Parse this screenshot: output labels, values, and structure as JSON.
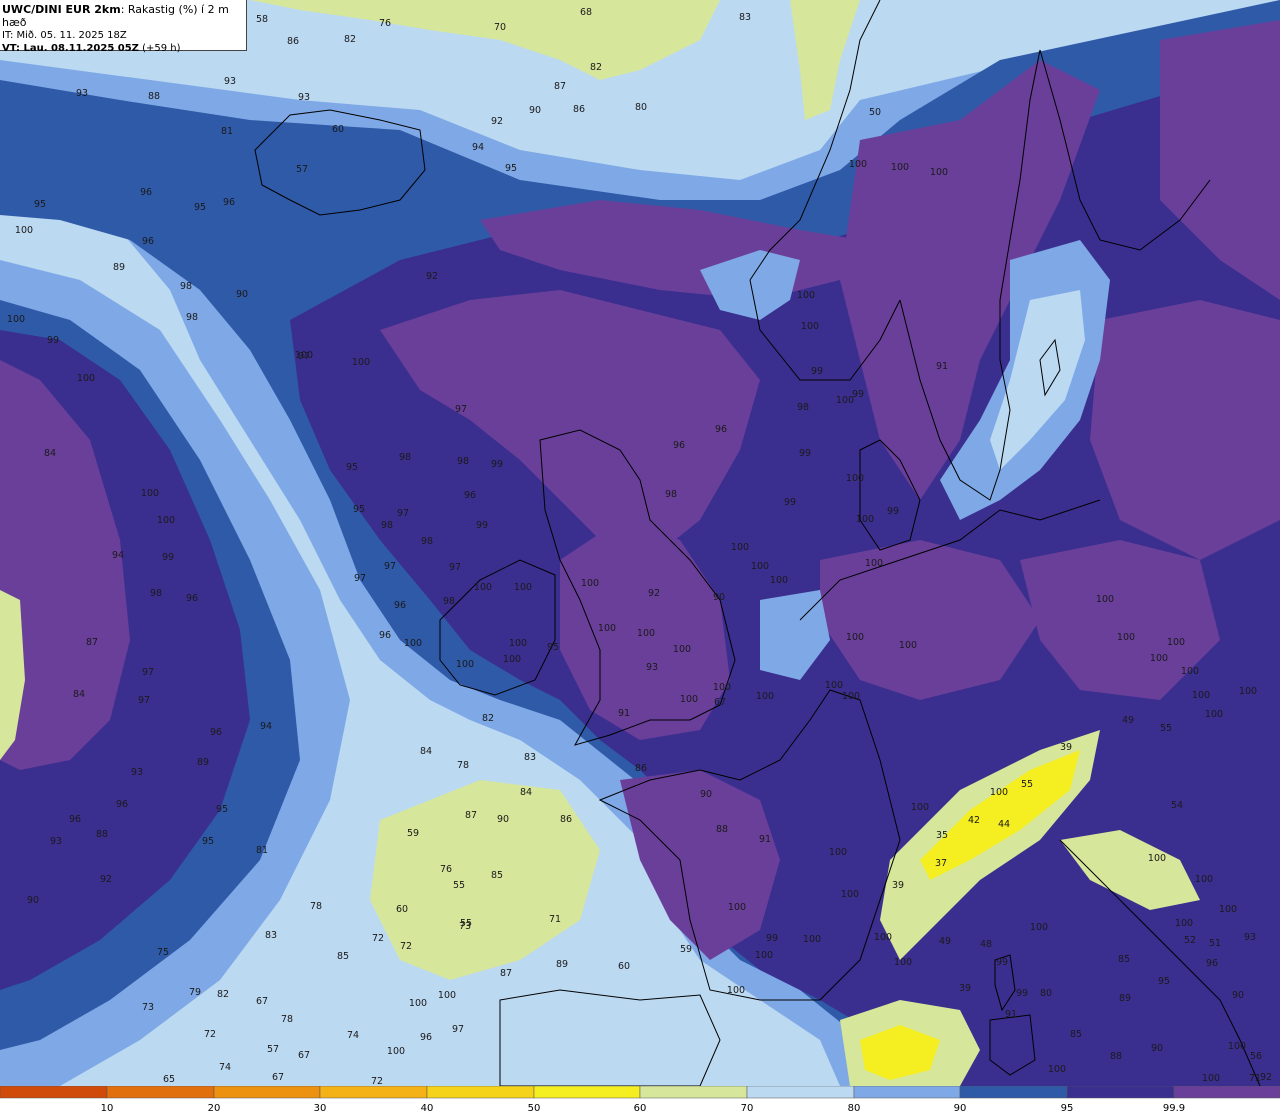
{
  "header": {
    "model": "UWC/DINI EUR 2km",
    "field": ": Rakastig (%) í 2 m hæð",
    "issue_time": "IT: Mið. 05. 11. 2025 18Z",
    "valid_label": "VT: Lau. 08.11.2025 05Z",
    "lead": " (+59 h)"
  },
  "colors": {
    "sea_low": "#bcd9f2",
    "level_80": "#7fa9e6",
    "level_90": "#2f5aa8",
    "level_95": "#3a2f8f",
    "level_99_9": "#6a3f9a",
    "dry_50": "#f5ef22",
    "dry_60": "#d6e69a",
    "coast": "#000000"
  },
  "colorbar": {
    "labels": [
      "10",
      "20",
      "30",
      "40",
      "50",
      "60",
      "70",
      "80",
      "90",
      "95",
      "99.9"
    ],
    "colors": [
      "#d04a0a",
      "#e1700c",
      "#ec9210",
      "#f4b216",
      "#f5d31a",
      "#f5ef22",
      "#d6e69a",
      "#bcd9f2",
      "#7fa9e6",
      "#2f5aa8",
      "#3a2f8f",
      "#6a3f9a"
    ]
  },
  "map_labels": [
    "58",
    "76",
    "70",
    "68",
    "83",
    "82",
    "86",
    "82",
    "90",
    "87",
    "86",
    "80",
    "88",
    "93",
    "93",
    "81",
    "93",
    "92",
    "60",
    "57",
    "95",
    "96",
    "95",
    "96",
    "100",
    "96",
    "89",
    "90",
    "92",
    "94",
    "95",
    "98",
    "98",
    "100",
    "100",
    "100",
    "99",
    "100",
    "84",
    "100",
    "100",
    "94",
    "99",
    "98",
    "96",
    "87",
    "97",
    "84",
    "97",
    "96",
    "94",
    "93",
    "89",
    "95",
    "96",
    "96",
    "88",
    "93",
    "95",
    "92",
    "90",
    "81",
    "83",
    "78",
    "84",
    "75",
    "79",
    "73",
    "67",
    "82",
    "78",
    "72",
    "85",
    "72",
    "72",
    "60",
    "55",
    "59",
    "76",
    "55",
    "57",
    "67",
    "74",
    "65",
    "67",
    "74",
    "72",
    "100",
    "100",
    "100",
    "96",
    "97",
    "97",
    "97",
    "98",
    "99",
    "98",
    "97",
    "97",
    "96",
    "99",
    "95",
    "95",
    "98",
    "98",
    "97",
    "97",
    "96",
    "96",
    "100",
    "98",
    "100",
    "100",
    "100",
    "100",
    "95",
    "100",
    "100",
    "100",
    "100",
    "93",
    "91",
    "86",
    "82",
    "78",
    "83",
    "84",
    "86",
    "90",
    "87",
    "85",
    "73",
    "71",
    "89",
    "87",
    "60",
    "59",
    "67",
    "90",
    "92",
    "100",
    "100",
    "100",
    "100",
    "100",
    "100",
    "100",
    "99",
    "98",
    "96",
    "96",
    "98",
    "100",
    "99",
    "99",
    "100",
    "99",
    "100",
    "100",
    "99",
    "100",
    "100",
    "100",
    "50",
    "91",
    "100",
    "100",
    "100",
    "100",
    "100",
    "100",
    "100",
    "100",
    "90",
    "88",
    "91",
    "100",
    "100",
    "100",
    "99",
    "100",
    "100",
    "100",
    "99",
    "100",
    "99",
    "100",
    "100",
    "55",
    "39",
    "42",
    "44",
    "35",
    "37",
    "39",
    "49",
    "48",
    "39",
    "91",
    "80",
    "85",
    "88",
    "90",
    "90",
    "100",
    "100",
    "56",
    "71",
    "54",
    "49",
    "55",
    "100",
    "100",
    "100",
    "100",
    "100",
    "100",
    "100",
    "100",
    "100",
    "100",
    "100",
    "100",
    "93",
    "85",
    "89",
    "95",
    "52",
    "51",
    "96",
    "92",
    "100",
    "99.9",
    "89",
    "91",
    "100",
    "99",
    "100",
    "93",
    "97",
    "96",
    "100",
    "100",
    "100",
    "57",
    "56"
  ]
}
